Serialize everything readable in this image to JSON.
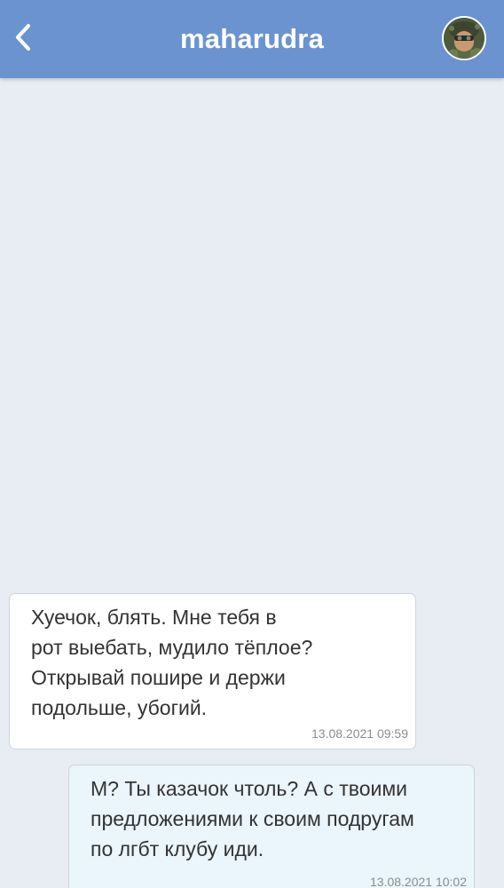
{
  "header": {
    "title": "maharudra",
    "back_icon": "chevron-left-icon",
    "avatar_icon": "user-avatar"
  },
  "colors": {
    "header_bg": "#6a93d0",
    "chat_bg": "#e8edf4",
    "incoming_bubble": "#ffffff",
    "outgoing_bubble": "#eaf5fc",
    "timestamp": "#8c8c8c"
  },
  "messages": [
    {
      "direction": "incoming",
      "text": "Хуечок, блять. Мне тебя в\nрот выебать, мудило тёплое?\nОткрывай пошире и держи\nподольше, убогий.",
      "time": "13.08.2021 09:59"
    },
    {
      "direction": "outgoing",
      "text": "М? Ты казачок чтоль? А с твоими\nпредложениями к своим подругам\nпо лгбт клубу иди.",
      "time": "13.08.2021 10:02"
    }
  ]
}
